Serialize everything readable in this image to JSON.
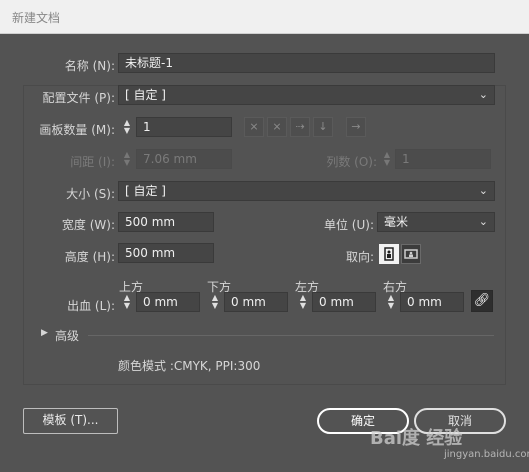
{
  "window": {
    "title": "新建文档"
  },
  "form": {
    "name_label": "名称 (N):",
    "name_value": "未标题-1",
    "profile_label": "配置文件 (P):",
    "profile_value": "[ 自定 ]",
    "artboards_label": "画板数量 (M):",
    "artboards_value": "1",
    "spacing_label": "间距 (I):",
    "spacing_value": "7.06 mm",
    "columns_label": "列数 (O):",
    "columns_value": "1",
    "size_label": "大小 (S):",
    "size_value": "[ 自定 ]",
    "width_label": "宽度 (W):",
    "width_value": "500 mm",
    "units_label": "单位 (U):",
    "units_value": "毫米",
    "height_label": "高度 (H):",
    "height_value": "500 mm",
    "orientation_label": "取向:",
    "bleed_label": "出血 (L):",
    "bleed_top_label": "上方",
    "bleed_top_value": "0 mm",
    "bleed_bottom_label": "下方",
    "bleed_bottom_value": "0 mm",
    "bleed_left_label": "左方",
    "bleed_left_value": "0 mm",
    "bleed_right_label": "右方",
    "bleed_right_value": "0 mm",
    "advanced_label": "高级",
    "color_mode_text": "颜色模式 :CMYK, PPI:300"
  },
  "buttons": {
    "templates": "模板 (T)...",
    "ok": "确定",
    "cancel": "取消"
  },
  "watermark": {
    "brand": "Bai度 经验",
    "url": "jingyan.baidu.com"
  },
  "icons": {
    "chevron": "chevron-down-icon",
    "stepper": "stepper-icon",
    "layout": [
      "grid-by-row-icon",
      "grid-by-column-icon",
      "arrange-by-row-icon",
      "arrange-by-column-icon",
      "right-to-left-icon"
    ],
    "portrait": "portrait-icon",
    "landscape": "landscape-icon",
    "link": "link-icon",
    "disclosure": "disclosure-triangle-icon"
  }
}
